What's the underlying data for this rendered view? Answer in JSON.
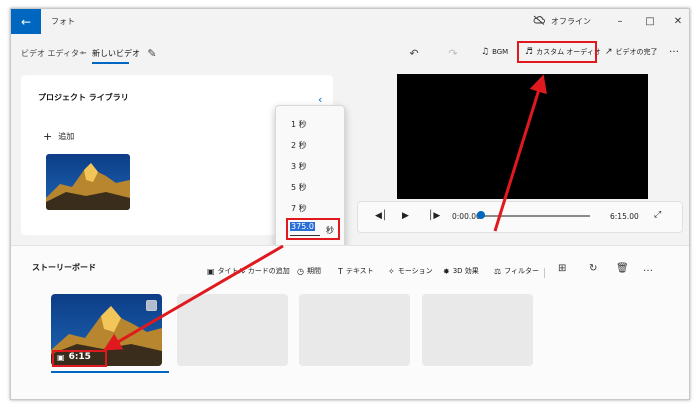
{
  "titlebar": {
    "back_icon": "arrow-left-icon",
    "app_title": "フォト",
    "offline_icon": "cloud-off-icon",
    "offline_label": "オフライン"
  },
  "toolbar": {
    "breadcrumb_root": "ビデオ エディター",
    "separator": "›",
    "project_name": "新しいビデオ",
    "bgm_label": "BGM",
    "custom_audio_label": "カスタム オーディオ",
    "finish_label": "ビデオの完了",
    "more_label": "…"
  },
  "library": {
    "title": "プロジェクト ライブラリ",
    "add_label": "追加"
  },
  "duration_popup": {
    "options": [
      "1 秒",
      "2 秒",
      "3 秒",
      "5 秒",
      "7 秒"
    ],
    "custom_value": "375.0",
    "unit": "秒"
  },
  "player": {
    "current_time": "0:00.00",
    "total_time": "6:15.00",
    "progress": 0
  },
  "storyboard": {
    "title": "ストーリーボード",
    "tools": {
      "title_card": "タイトル カードの追加",
      "duration": "期間",
      "text": "テキスト",
      "motion": "モーション",
      "effects_3d": "3D 効果",
      "filter": "フィルター"
    },
    "clip_duration": "6:15"
  },
  "colors": {
    "accent": "#0067c0",
    "highlight": "#e0191f"
  }
}
